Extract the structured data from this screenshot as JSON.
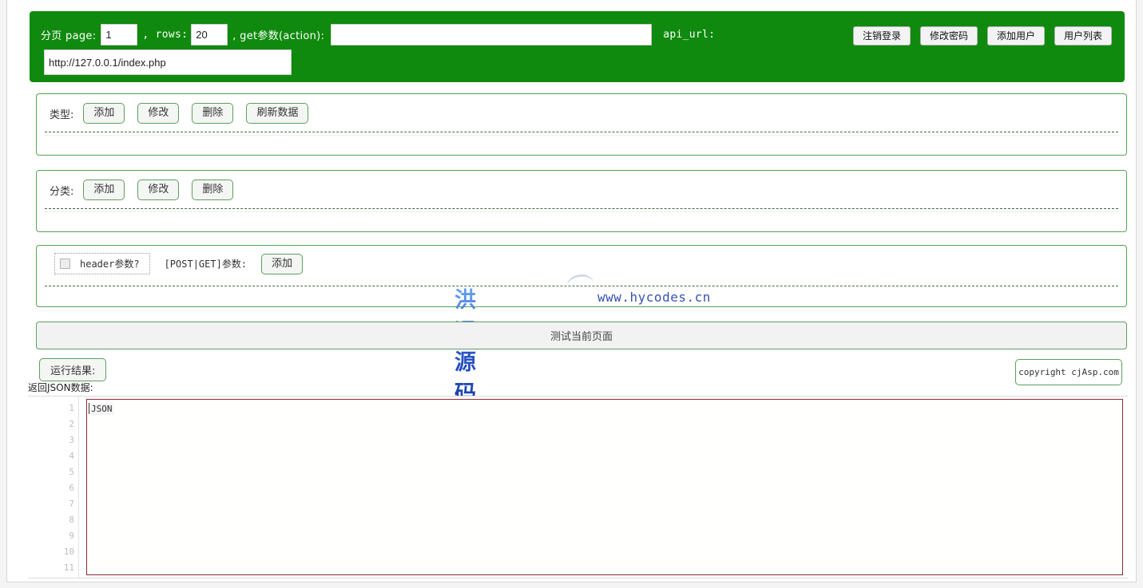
{
  "header": {
    "paging_label": "分页 page:",
    "page_value": "1",
    "rows_label": ", rows:",
    "rows_value": "20",
    "action_label": ", get参数(action):",
    "action_value": "",
    "action_placeholder": "",
    "api_url_label": "api_url:",
    "url_value": "http://127.0.0.1/index.php",
    "url_placeholder": "",
    "buttons": [
      {
        "label": "注销登录",
        "name": "logout-button"
      },
      {
        "label": "修改密码",
        "name": "change-password-button"
      },
      {
        "label": "添加用户",
        "name": "add-user-button"
      },
      {
        "label": "用户列表",
        "name": "user-list-button"
      }
    ],
    "accent_color": "#108a0e"
  },
  "type_panel": {
    "label": "类型:",
    "buttons": [
      {
        "label": "添加",
        "name": "type-add-button"
      },
      {
        "label": "修改",
        "name": "type-edit-button"
      },
      {
        "label": "删除",
        "name": "type-delete-button"
      },
      {
        "label": "刷新数据",
        "name": "type-refresh-button"
      }
    ]
  },
  "category_panel": {
    "label": "分类:",
    "buttons": [
      {
        "label": "添加",
        "name": "category-add-button"
      },
      {
        "label": "修改",
        "name": "category-edit-button"
      },
      {
        "label": "删除",
        "name": "category-delete-button"
      }
    ]
  },
  "params_panel": {
    "header_checkbox_label": "header参数?",
    "header_checkbox_checked": false,
    "post_get_label": "[POST|GET]参数:",
    "add_button_label": "添加"
  },
  "watermark": {
    "brand": "洪运源码",
    "url": "www.hycodes.cn",
    "brand_color": "#2a55c8"
  },
  "test_bar": {
    "label": "测试当前页面"
  },
  "results": {
    "run_result_label": "运行结果:",
    "copyright_label": "copyright cjAsp.com",
    "json_label": "返回JSON数据:"
  },
  "editor": {
    "line_numbers": [
      "1",
      "2",
      "3",
      "4",
      "5",
      "6",
      "7",
      "8",
      "9",
      "10",
      "11"
    ],
    "content_line_1": "JSON",
    "border_color": "#8b2b33"
  }
}
